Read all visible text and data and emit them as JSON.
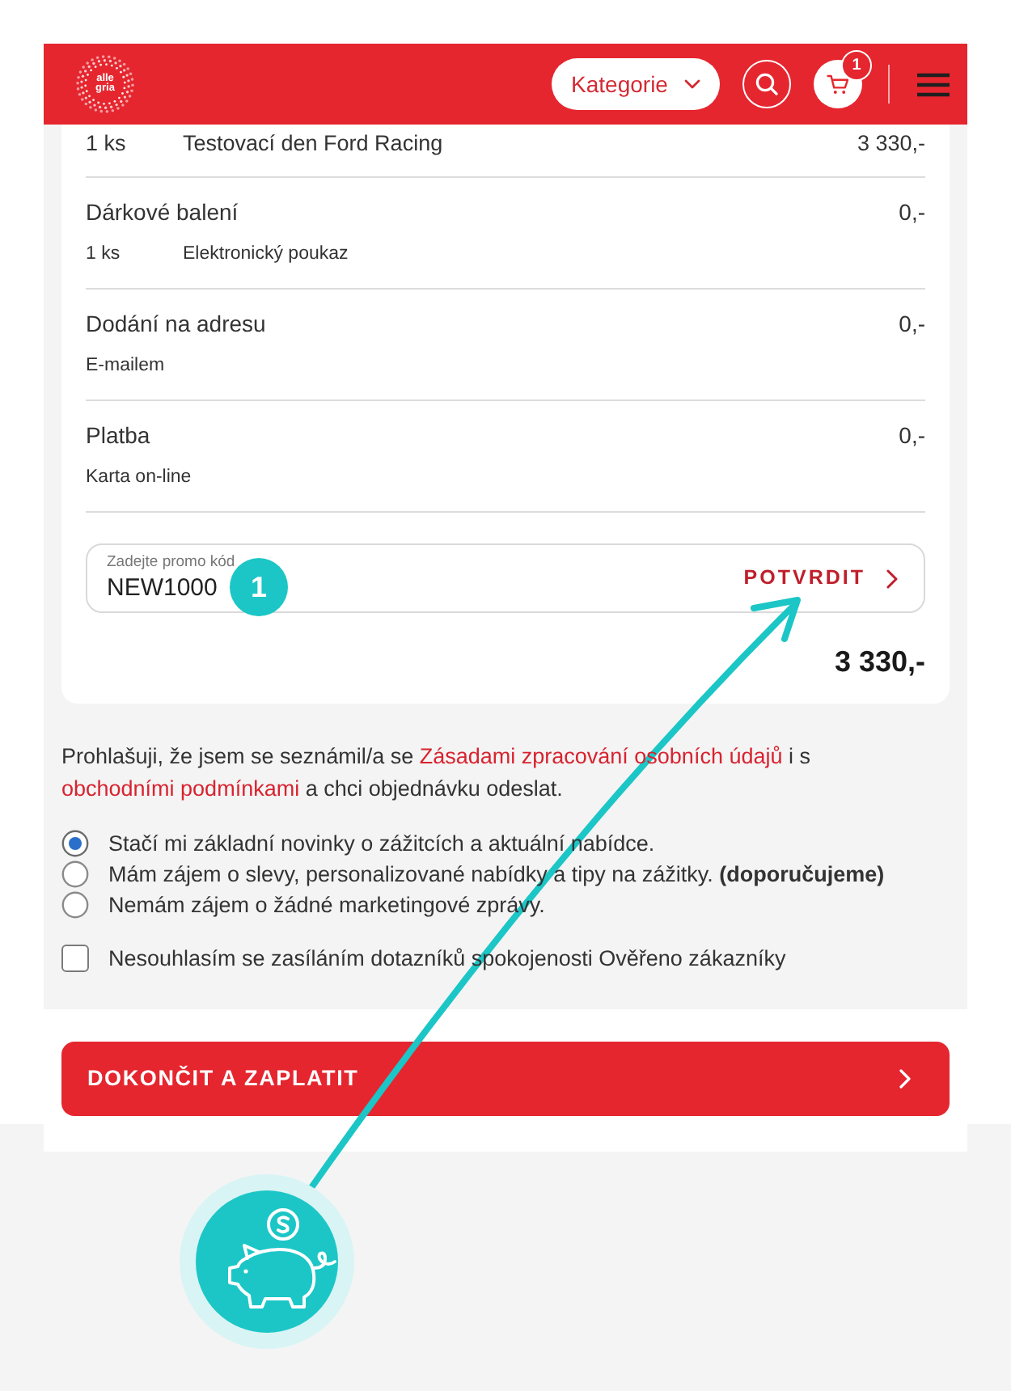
{
  "header": {
    "logo": {
      "lines": [
        "alle",
        "gria"
      ]
    },
    "category_button": "Kategorie",
    "cart_count": "1"
  },
  "order_items": [
    {
      "kind": "item",
      "quantity": "1 ks",
      "name": "Testovací den Ford Racing",
      "price": "3 330,-"
    },
    {
      "kind": "section",
      "title": "Dárkové balení",
      "price": "0,-",
      "detail_quantity": "1 ks",
      "detail": "Elektronický poukaz"
    },
    {
      "kind": "section",
      "title": "Dodání na adresu",
      "price": "0,-",
      "detail": "E-mailem"
    },
    {
      "kind": "section",
      "title": "Platba",
      "price": "0,-",
      "detail": "Karta on-line"
    }
  ],
  "promo": {
    "label": "Zadejte promo kód",
    "value": "NEW1000",
    "button": "POTVRDIT"
  },
  "total": "3 330,-",
  "consent_text": [
    {
      "kind": "text",
      "text": "Prohlašuji, že jsem se seznámil/a se "
    },
    {
      "kind": "link",
      "text": "Zásadami zpracování osobních údajů"
    },
    {
      "kind": "text",
      "text": " i s "
    },
    {
      "kind": "link",
      "text": "obchodními podmínkami"
    },
    {
      "kind": "text",
      "text": " a chci objednávku odeslat."
    }
  ],
  "marketing_options": [
    {
      "label": "Stačí mi základní novinky o zážitcích a aktuální nabídce.",
      "selected": true
    },
    {
      "label": "Mám zájem o slevy, personalizované nabídky a tipy na zážitky. **(doporučujeme)**",
      "selected": false
    },
    {
      "label": "Nemám zájem o žádné marketingové zprávy.",
      "selected": false
    }
  ],
  "survey_opt_out": {
    "label": "Nesouhlasím se zasíláním dotazníků spokojenosti Ověřeno zákazníky",
    "checked": false
  },
  "submit_button": "DOKONČIT A ZAPLATIT",
  "annotation": {
    "step_marker": "1"
  }
}
